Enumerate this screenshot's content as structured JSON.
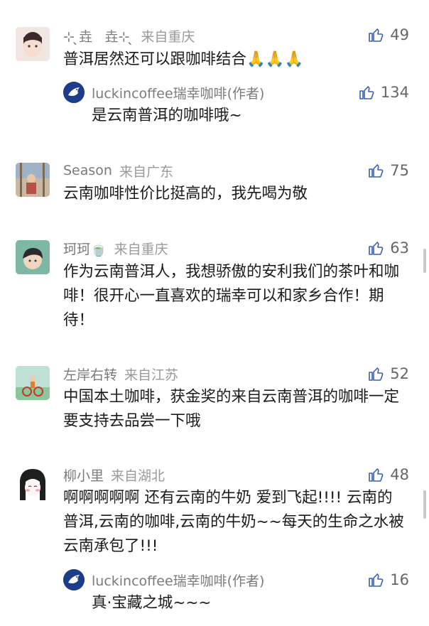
{
  "comments": [
    {
      "name": "⊹ ̖̖̖̖垚ㅤ垚⊹ ̖̖̖̖",
      "location": "来自重庆",
      "text": "普洱居然还可以跟咖啡结合🙏🙏🙏",
      "likes": "49",
      "reply": {
        "name": "luckincoffee瑞幸咖啡(作者)",
        "text": "是云南普洱的咖啡哦~",
        "likes": "134"
      }
    },
    {
      "name": "Season",
      "location": "来自广东",
      "text": "云南咖啡性价比挺高的，我先喝为敬",
      "likes": "75"
    },
    {
      "name": "珂珂🍵",
      "location": "来自重庆",
      "text": "作为云南普洱人，我想骄傲的安利我们的茶叶和咖啡！很开心一直喜欢的瑞幸可以和家乡合作！期待！",
      "likes": "63"
    },
    {
      "name": "左岸右转",
      "location": "来自江苏",
      "text": "中国本土咖啡，获金奖的来自云南普洱的咖啡一定要支持去品尝一下哦",
      "likes": "52"
    },
    {
      "name": "柳小里",
      "location": "来自湖北",
      "text": "啊啊啊啊啊 还有云南的牛奶 爱到飞起!!!! 云南的普洱,云南的咖啡,云南的牛奶~~每天的生命之水被云南承包了!!!",
      "likes": "48",
      "reply": {
        "name": "luckincoffee瑞幸咖啡(作者)",
        "text": "真·宝藏之城~~~",
        "likes": "16"
      }
    }
  ],
  "colors": {
    "meta": "#7b7b7b",
    "text": "#1a1a1a",
    "brand": "#1d3c8a",
    "scrollbar": "#c8c8c8"
  }
}
